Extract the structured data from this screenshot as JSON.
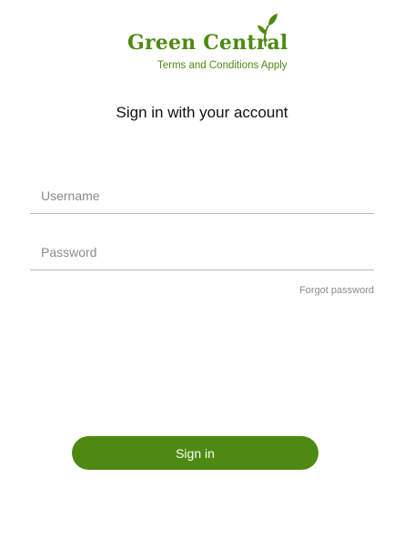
{
  "logo": {
    "name": "Green Central",
    "tagline": "Terms and Conditions Apply"
  },
  "heading": "Sign in with your account",
  "form": {
    "username": {
      "value": "",
      "placeholder": "Username"
    },
    "password": {
      "value": "",
      "placeholder": "Password"
    },
    "forgot_label": "Forgot password",
    "submit_label": "Sign in"
  },
  "colors": {
    "brand": "#4e8a12",
    "placeholder": "#8a8a8a",
    "underline": "#b8b8b8"
  },
  "icons": {
    "logo_leaf": "leaf-icon"
  }
}
